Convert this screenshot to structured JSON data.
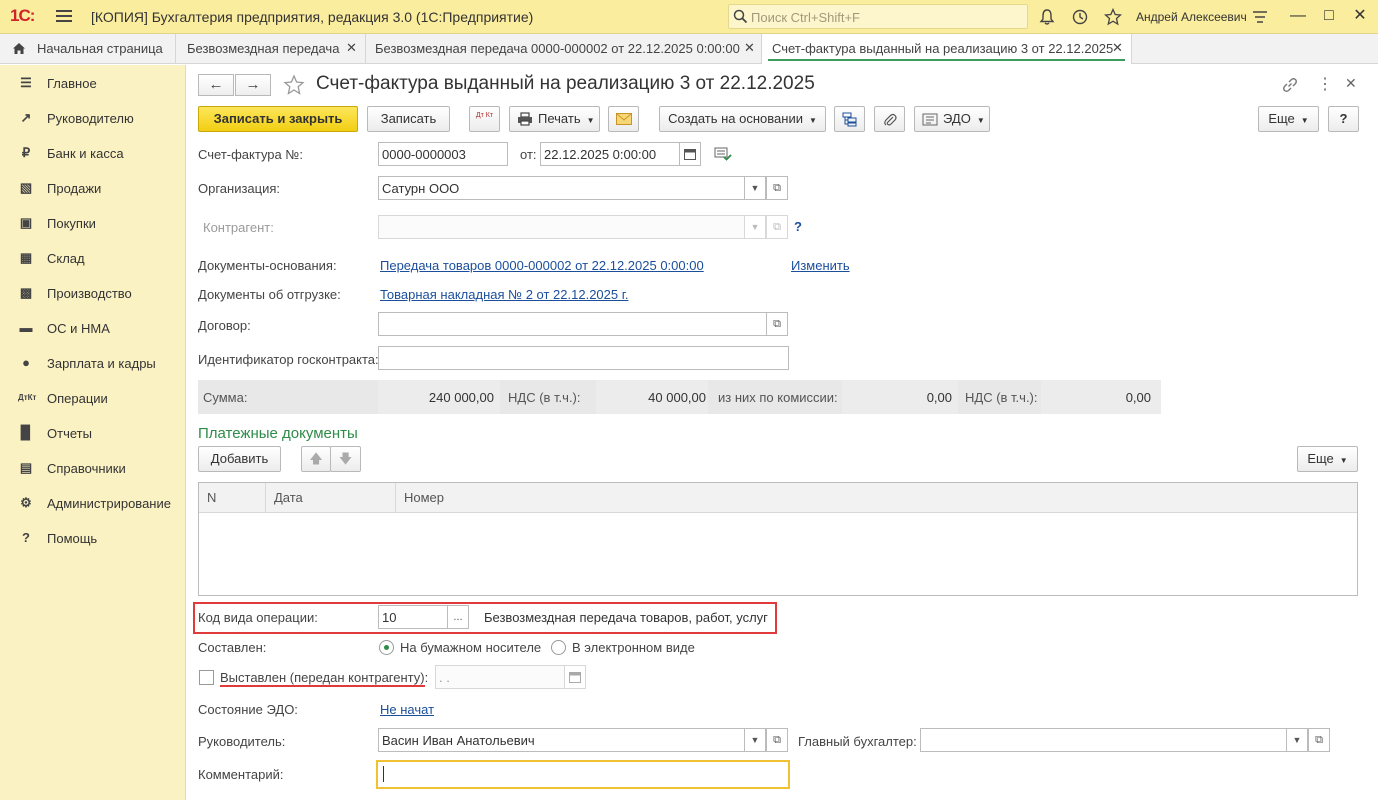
{
  "titlebar": {
    "logo": "1С:",
    "title": "[КОПИЯ] Бухгалтерия предприятия, редакция 3.0  (1С:Предприятие)",
    "search_placeholder": "Поиск Ctrl+Shift+F",
    "user": "Андрей Алексеевич"
  },
  "tabs": [
    {
      "label": "Начальная страница"
    },
    {
      "label": "Безвозмездная передача"
    },
    {
      "label": "Безвозмездная передача 0000-000002 от 22.12.2025 0:00:00"
    },
    {
      "label": "Счет-фактура выданный на реализацию 3 от 22.12.2025"
    }
  ],
  "sidebar": {
    "items": [
      {
        "label": "Главное",
        "icon": "menu-icon"
      },
      {
        "label": "Руководителю",
        "icon": "trend-icon"
      },
      {
        "label": "Банк и касса",
        "icon": "ruble-icon"
      },
      {
        "label": "Продажи",
        "icon": "bag-icon"
      },
      {
        "label": "Покупки",
        "icon": "cart-icon"
      },
      {
        "label": "Склад",
        "icon": "warehouse-icon"
      },
      {
        "label": "Производство",
        "icon": "factory-icon"
      },
      {
        "label": "ОС и НМА",
        "icon": "truck-icon"
      },
      {
        "label": "Зарплата и кадры",
        "icon": "person-icon"
      },
      {
        "label": "Операции",
        "icon": "dt-kt-icon"
      },
      {
        "label": "Отчеты",
        "icon": "chart-icon"
      },
      {
        "label": "Справочники",
        "icon": "books-icon"
      },
      {
        "label": "Администрирование",
        "icon": "gear-icon"
      },
      {
        "label": "Помощь",
        "icon": "help-icon"
      }
    ]
  },
  "document": {
    "title": "Счет-фактура выданный на реализацию 3 от 22.12.2025"
  },
  "toolbar": {
    "save_close": "Записать и закрыть",
    "save": "Записать",
    "dtkt": "Дт Кт",
    "print": "Печать",
    "create_based": "Создать на основании",
    "edo": "ЭДО",
    "more": "Еще",
    "help": "?"
  },
  "form": {
    "invoice_no_label": "Счет-фактура №:",
    "invoice_no": "0000-0000003",
    "from_label": "от:",
    "date": "22.12.2025  0:00:00",
    "org_label": "Организация:",
    "org": "Сатурн ООО",
    "counterparty_label": "Контрагент:",
    "counterparty": "",
    "counterparty_help": "?",
    "base_docs_label": "Документы-основания:",
    "base_docs": "Передача товаров 0000-000002 от 22.12.2025 0:00:00",
    "change_link": "Изменить",
    "shipment_docs_label": "Документы об отгрузке:",
    "shipment_docs": "Товарная накладная № 2 от 22.12.2025 г.",
    "contract_label": "Договор:",
    "contract": "",
    "gov_contract_label": "Идентификатор госконтракта:",
    "gov_contract": ""
  },
  "totals": {
    "sum_label": "Сумма:",
    "sum": "240 000,00",
    "vat_label": "НДС (в т.ч.):",
    "vat": "40 000,00",
    "commission_label": "из них по комиссии:",
    "commission": "0,00",
    "vat2_label": "НДС (в т.ч.):",
    "vat2": "0,00"
  },
  "payments": {
    "title": "Платежные документы",
    "add": "Добавить",
    "more": "Еще",
    "columns": [
      "N",
      "Дата",
      "Номер"
    ]
  },
  "operation": {
    "code_label": "Код вида операции:",
    "code": "10",
    "code_button": "...",
    "code_desc": "Безвозмездная передача товаров, работ, услуг"
  },
  "compiled": {
    "label": "Составлен:",
    "option_paper": "На бумажном носителе",
    "option_electronic": "В электронном виде"
  },
  "issued": {
    "label": "Выставлен (передан контрагенту):",
    "date": "  .  ."
  },
  "edo_state": {
    "label": "Состояние ЭДО:",
    "value": "Не начат"
  },
  "signers": {
    "head_label": "Руководитель:",
    "head": "Васин Иван Анатольевич",
    "chief_acc_label": "Главный бухгалтер:",
    "chief_acc": ""
  },
  "comment": {
    "label": "Комментарий:",
    "value": ""
  },
  "colors": {
    "titlebar_bg": "#fbed9e",
    "sidebar_bg": "#fbf2c4",
    "primary_btn": "#f2cf12",
    "link": "#1b4f9c",
    "section_green": "#2e8b48",
    "highlight_red": "#e03a3a"
  }
}
